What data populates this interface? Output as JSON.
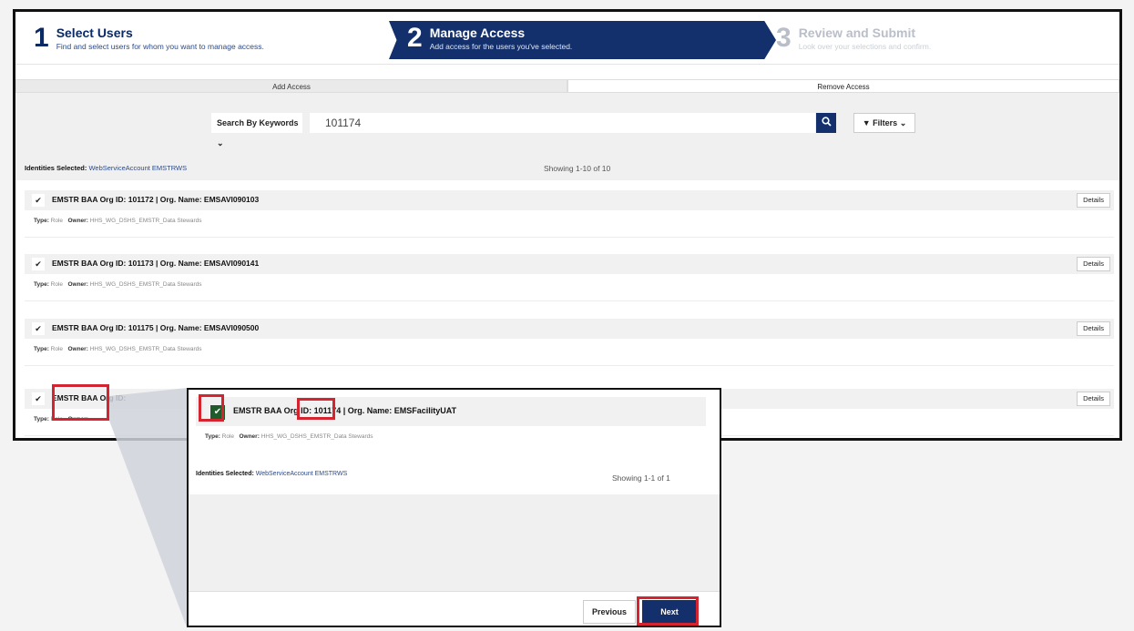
{
  "wizard": {
    "steps": [
      {
        "number": "1",
        "title": "Select Users",
        "subtitle": "Find and select users for whom you want to manage access."
      },
      {
        "number": "2",
        "title": "Manage Access",
        "subtitle": "Add access for the users you've selected."
      },
      {
        "number": "3",
        "title": "Review and Submit",
        "subtitle": "Look over your selections and confirm."
      }
    ]
  },
  "tabs": {
    "add": "Add Access",
    "remove": "Remove Access"
  },
  "search": {
    "keyword_select": "Search By Keywords",
    "value": "101174",
    "filters_label": "Filters"
  },
  "results": {
    "identities_label": "Identities Selected:",
    "identities_value": "WebServiceAccount EMSTRWS",
    "showing": "Showing 1-10 of 10",
    "details_label": "Details",
    "type_label": "Type:",
    "owner_label": "Owner:",
    "rows": [
      {
        "name": "EMSTR BAA Org ID: 101172 | Org. Name: EMSAVI090103",
        "type": "Role",
        "owner": "HHS_WG_DSHS_EMSTR_Data Stewards"
      },
      {
        "name": "EMSTR BAA Org ID: 101173 | Org. Name: EMSAVI090141",
        "type": "Role",
        "owner": "HHS_WG_DSHS_EMSTR_Data Stewards"
      },
      {
        "name": "EMSTR BAA Org ID: 101175 | Org. Name: EMSAVI090500",
        "type": "Role",
        "owner": "HHS_WG_DSHS_EMSTR_Data Stewards"
      },
      {
        "name": "EMSTR BAA Org ID:",
        "type": "Role",
        "owner": ""
      }
    ]
  },
  "zoom": {
    "row_name": "EMSTR BAA Org ID: 101174 | Org. Name: EMSFacilityUAT",
    "type": "Role",
    "owner": "HHS_WG_DSHS_EMSTR_Data Stewards",
    "identities_label": "Identities Selected:",
    "identities_value": "WebServiceAccount EMSTRWS",
    "showing": "Showing 1-1 of 1",
    "previous_label": "Previous",
    "next_label": "Next"
  },
  "icons": {
    "check": "✔",
    "search": "🔍",
    "chevron": "⌄",
    "filter": "▼"
  },
  "colors": {
    "primary": "#13306c",
    "highlight": "#d3242f",
    "checked": "#1f5c2a"
  }
}
